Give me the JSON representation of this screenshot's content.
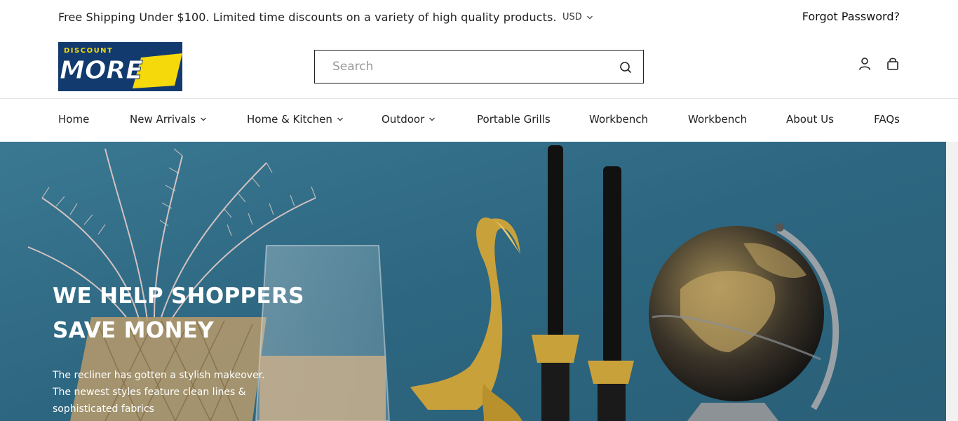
{
  "announcement": {
    "text": "Free Shipping Under $100. Limited time discounts on a variety of high quality products.",
    "currency": "USD",
    "forgot_password": "Forgot Password?"
  },
  "logo": {
    "small_text": "DISCOUNT",
    "big_text": "MORE",
    "colors": {
      "background": "#123a6e",
      "accent": "#f5d90a"
    }
  },
  "search": {
    "placeholder": "Search",
    "value": ""
  },
  "header_icons": [
    "user-icon",
    "bag-icon"
  ],
  "nav": {
    "items": [
      {
        "label": "Home",
        "has_dropdown": false
      },
      {
        "label": "New Arrivals",
        "has_dropdown": true
      },
      {
        "label": "Home & Kitchen",
        "has_dropdown": true
      },
      {
        "label": "Outdoor",
        "has_dropdown": true
      },
      {
        "label": "Portable Grills",
        "has_dropdown": false
      },
      {
        "label": "Workbench",
        "has_dropdown": false
      },
      {
        "label": "Workbench",
        "has_dropdown": false
      },
      {
        "label": "About Us",
        "has_dropdown": false
      },
      {
        "label": "FAQs",
        "has_dropdown": false
      }
    ]
  },
  "hero": {
    "title_line1": "WE HELP SHOPPERS",
    "title_line2": "SAVE MONEY",
    "subtitle_line1": "The recliner has gotten a stylish makeover.",
    "subtitle_line2": "The newest styles feature clean lines & sophisticated fabrics",
    "colors": {
      "wall": "#2f6a82",
      "brass": "#c9a13b",
      "candle": "#111111"
    }
  }
}
